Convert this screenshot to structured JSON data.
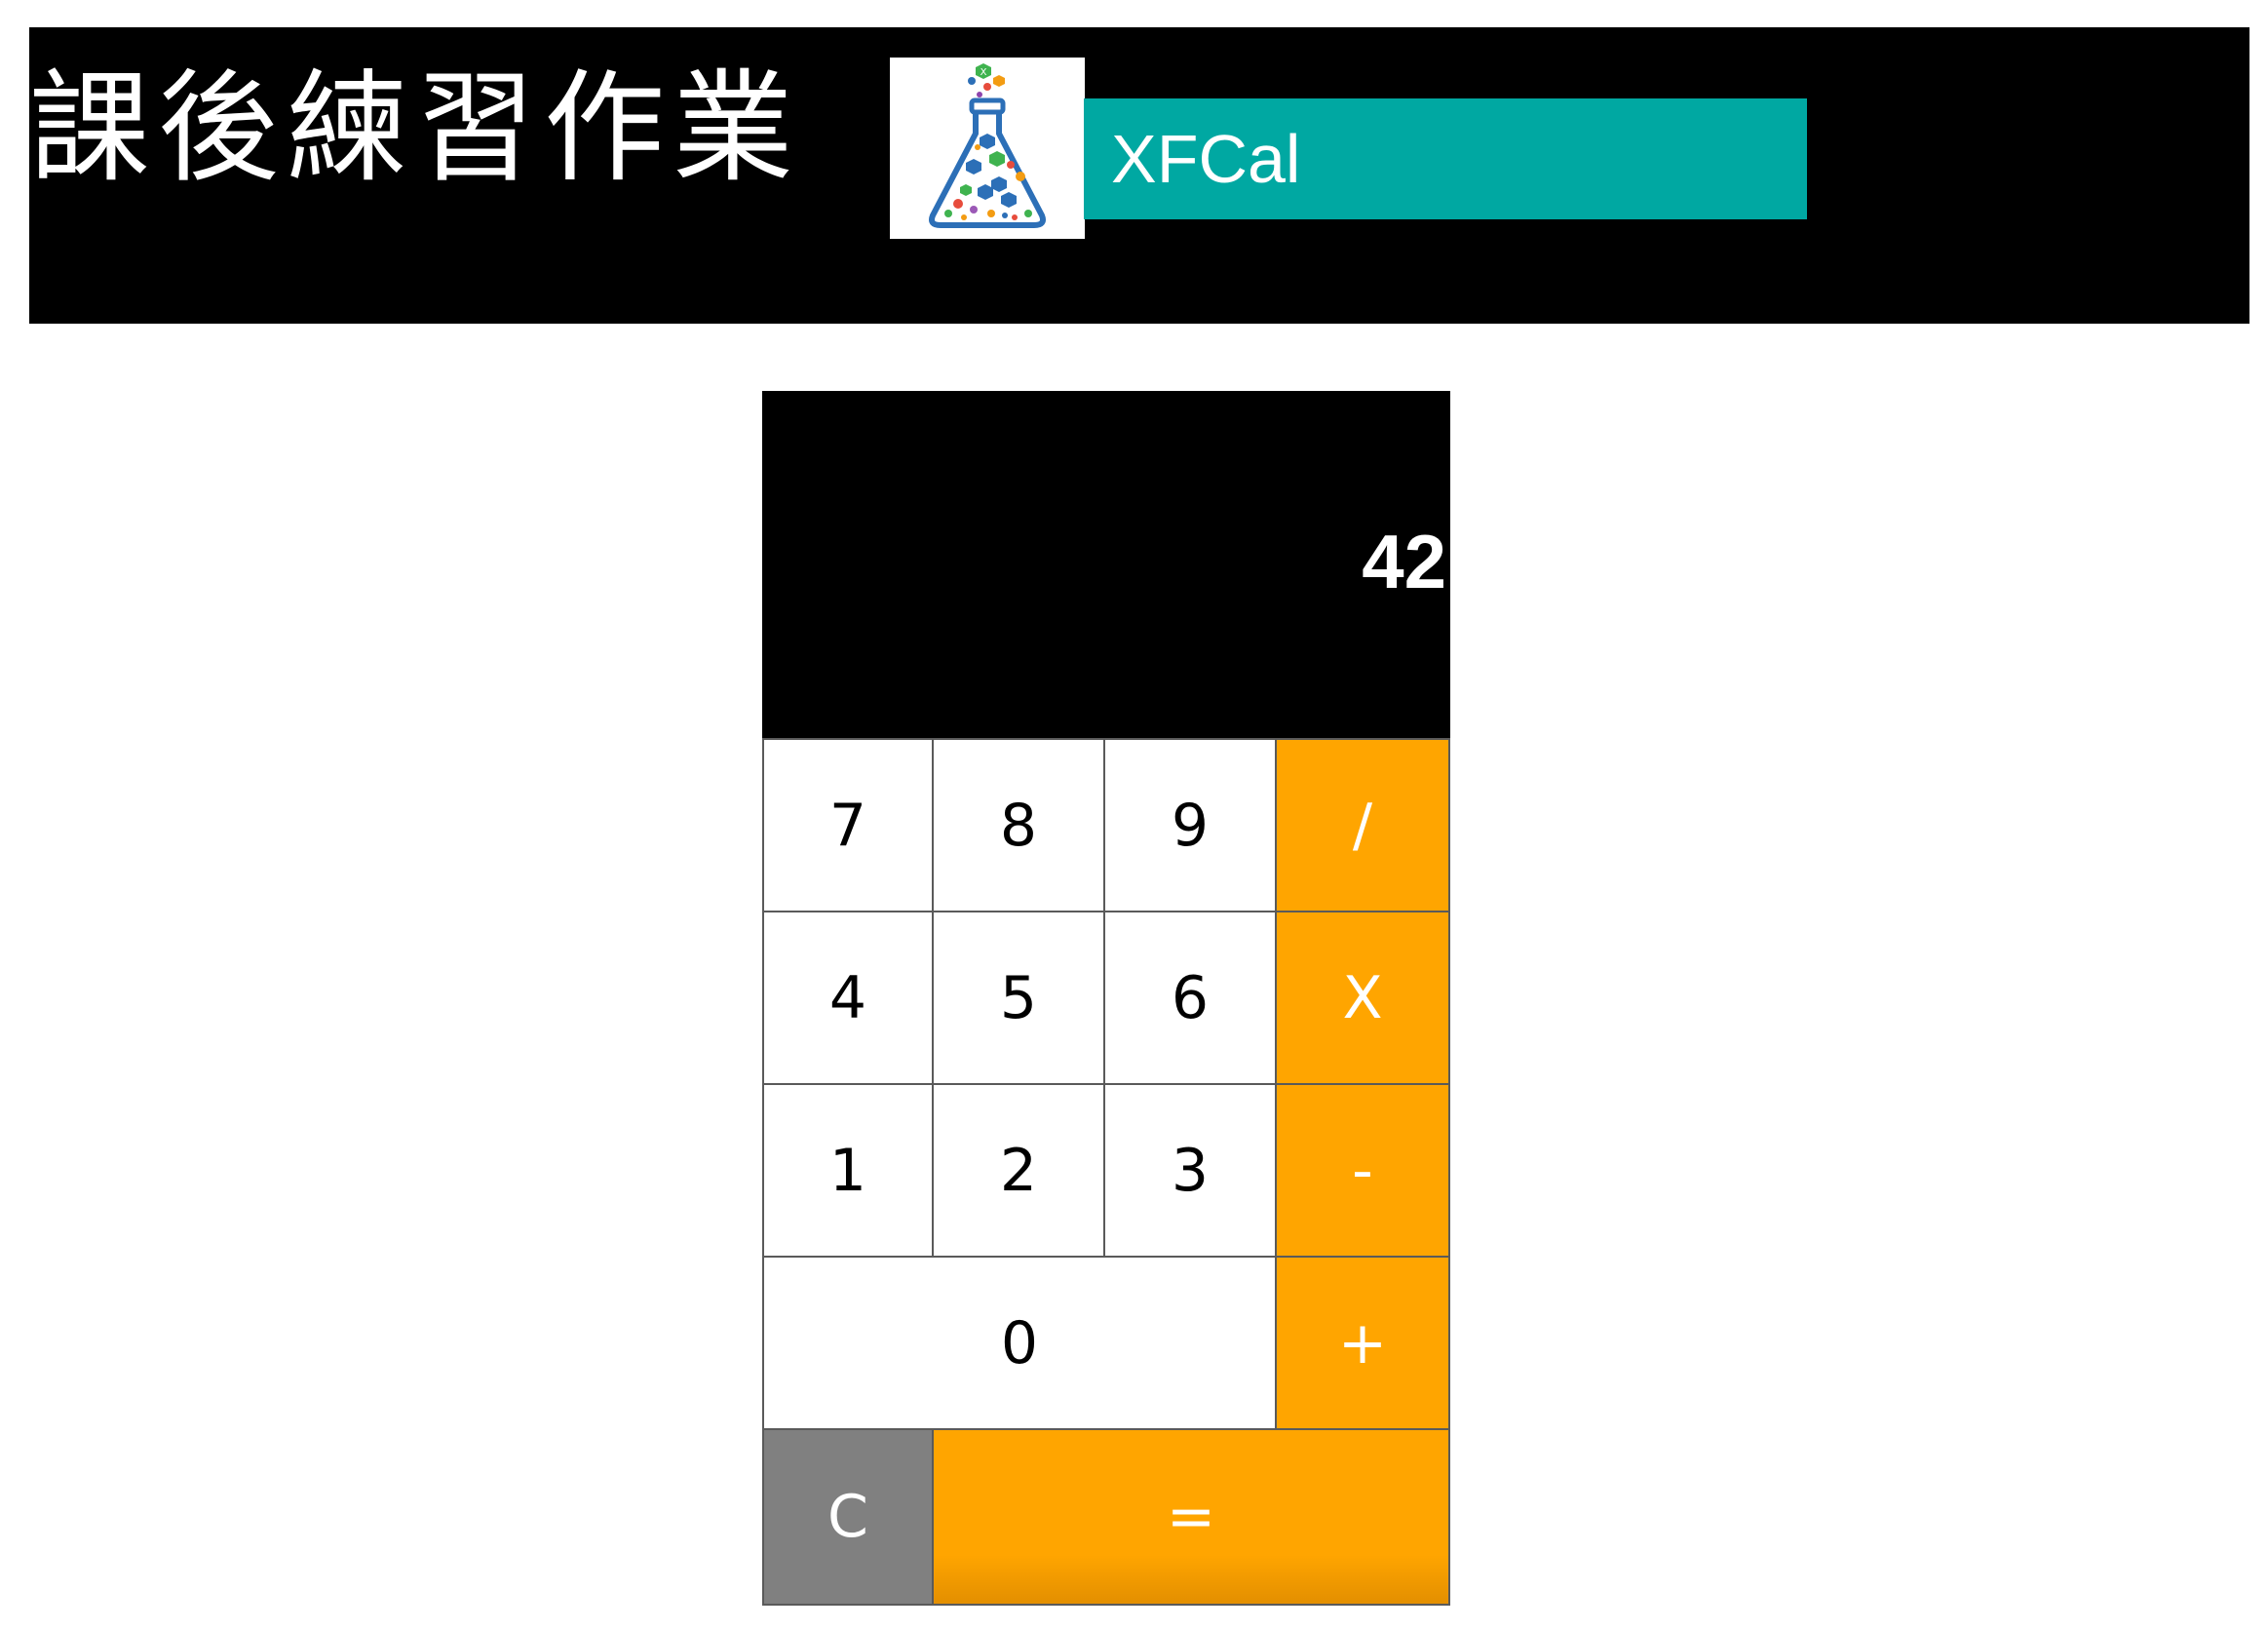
{
  "banner": {
    "title": "課後練習作業",
    "app_name": "XFCal",
    "logo_icon": "flask-logo-icon"
  },
  "calculator": {
    "display": "42",
    "keys": {
      "seven": "7",
      "eight": "8",
      "nine": "9",
      "divide": "/",
      "four": "4",
      "five": "5",
      "six": "6",
      "multiply": "X",
      "one": "1",
      "two": "2",
      "three": "3",
      "subtract": "-",
      "zero": "0",
      "add": "+",
      "clear": "C",
      "equals": "="
    }
  },
  "colors": {
    "banner_bg": "#000000",
    "app_name_bar": "#00a8a2",
    "operator_key": "#ffa500",
    "number_key": "#ffffff",
    "clear_key": "#808080",
    "display_bg": "#000000"
  }
}
